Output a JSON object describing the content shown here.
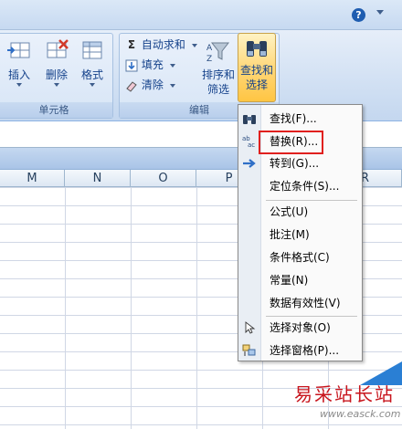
{
  "ribbon": {
    "help_icon": "?",
    "cells_group": {
      "label": "单元格",
      "insert_label": "插入",
      "delete_label": "删除",
      "format_label": "格式"
    },
    "editing_group": {
      "label": "编辑",
      "autosum_label": "自动求和",
      "autosum_icon": "Σ",
      "fill_label": "填充",
      "clear_label": "清除",
      "sort_filter_label_1": "排序和",
      "sort_filter_label_2": "筛选",
      "find_select_label_1": "查找和",
      "find_select_label_2": "选择"
    }
  },
  "columns": [
    "M",
    "N",
    "O",
    "P",
    "R"
  ],
  "menu": {
    "items": [
      {
        "label": "查找(F)...",
        "icon": "binoculars-icon"
      },
      {
        "label": "替换(R)...",
        "icon": "replace-icon"
      },
      {
        "label": "转到(G)...",
        "icon": "arrow-right-icon"
      },
      {
        "label": "定位条件(S)...",
        "icon": ""
      },
      {
        "label": "公式(U)",
        "icon": ""
      },
      {
        "label": "批注(M)",
        "icon": ""
      },
      {
        "label": "条件格式(C)",
        "icon": ""
      },
      {
        "label": "常量(N)",
        "icon": ""
      },
      {
        "label": "数据有效性(V)",
        "icon": ""
      },
      {
        "label": "选择对象(O)",
        "icon": "pointer-icon"
      },
      {
        "label": "选择窗格(P)...",
        "icon": "selection-pane-icon"
      }
    ],
    "highlight_color": "#e0201e"
  },
  "watermark": {
    "title": "易采站长站",
    "url": "www.easck.com"
  }
}
